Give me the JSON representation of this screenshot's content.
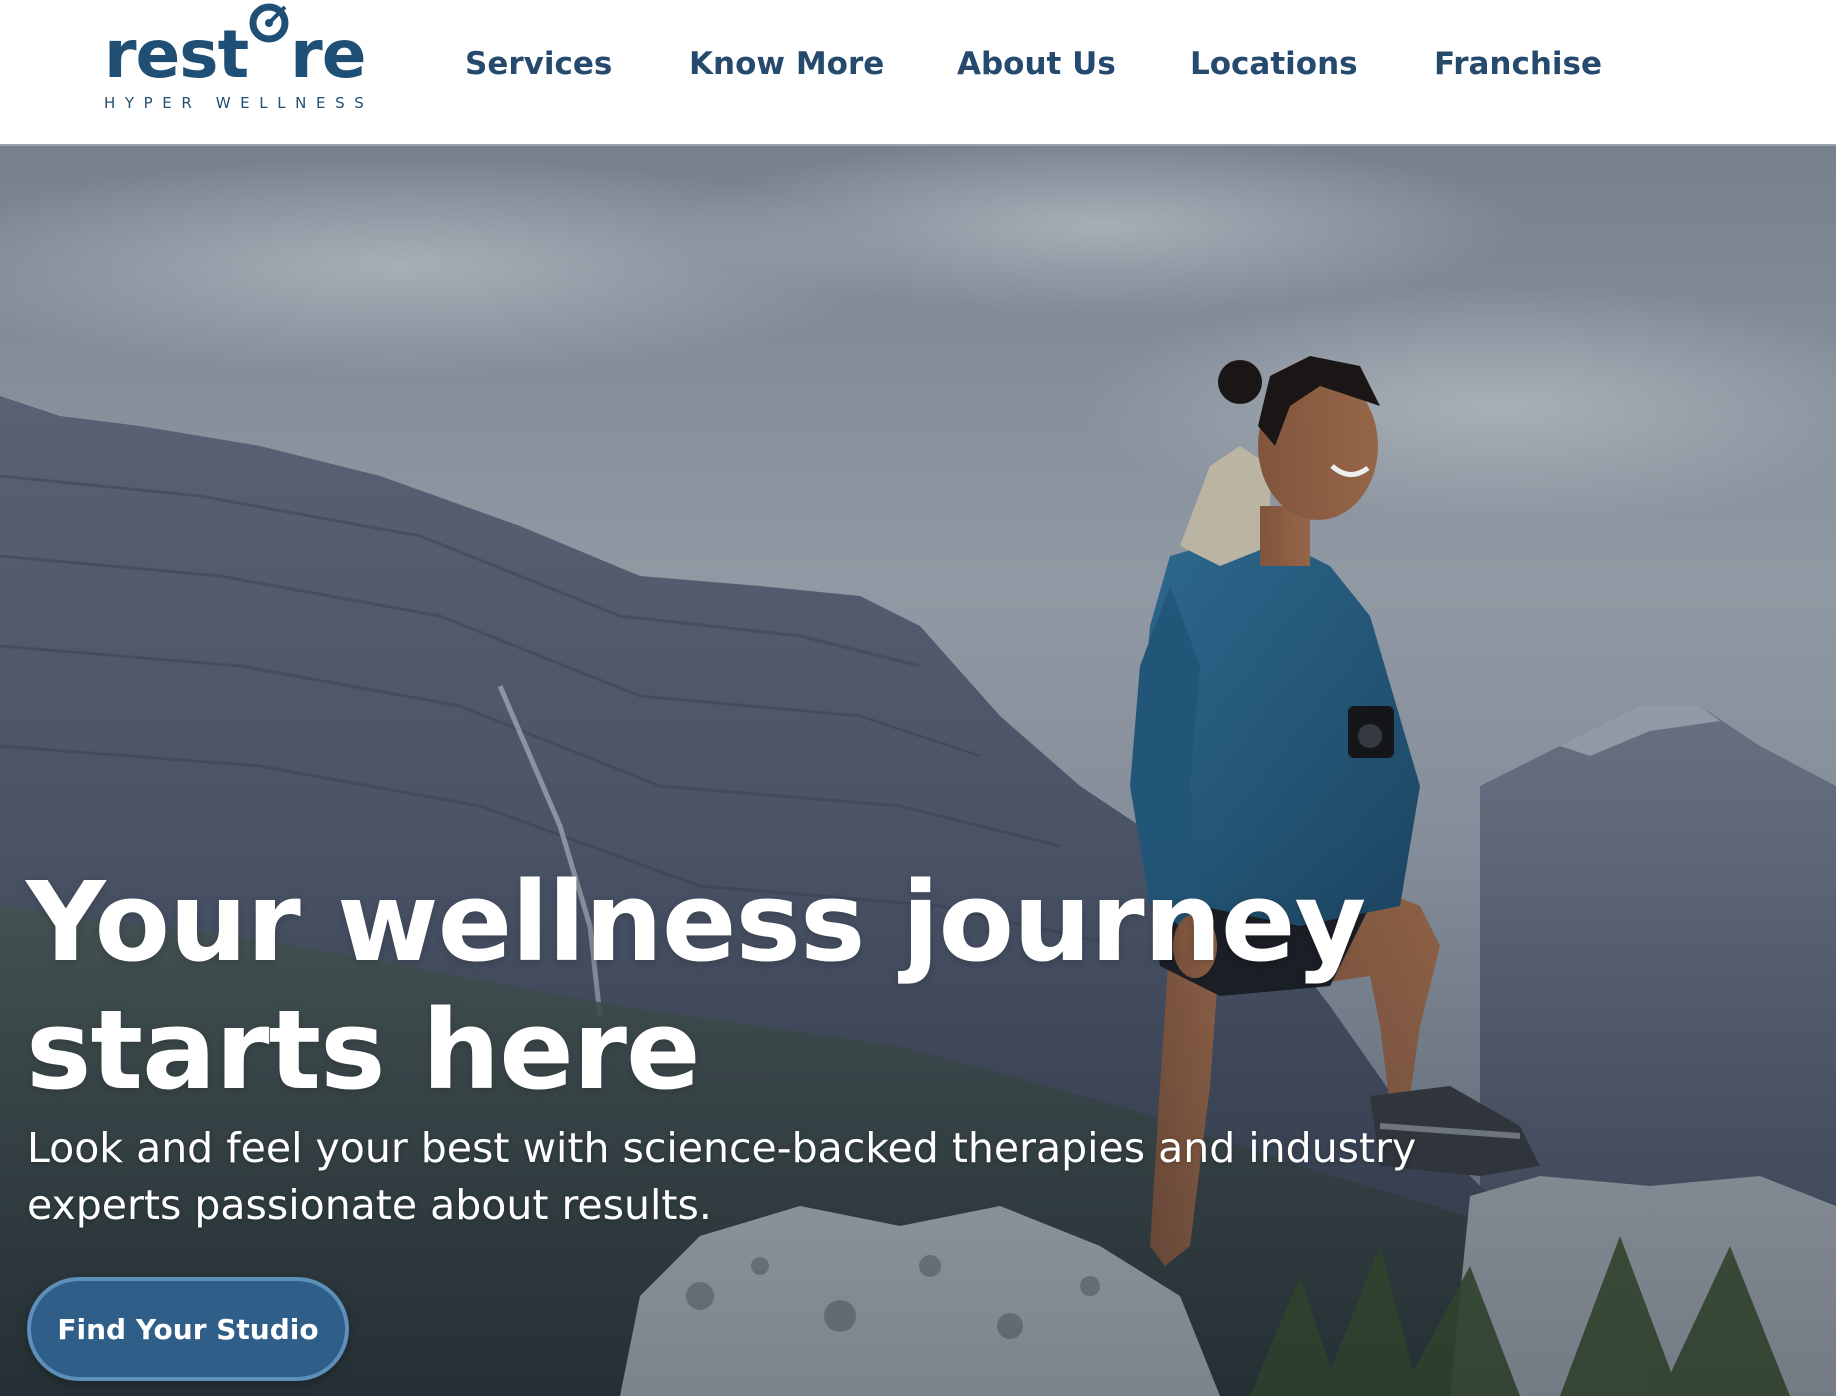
{
  "brand": {
    "logo_word": "restore",
    "logo_prefix": "rest",
    "logo_suffix": "re",
    "tagline": "HYPER WELLNESS",
    "color": "#1f4f74"
  },
  "nav": {
    "items": [
      {
        "label": "Services"
      },
      {
        "label": "Know More"
      },
      {
        "label": "About Us"
      },
      {
        "label": "Locations"
      },
      {
        "label": "Franchise"
      }
    ]
  },
  "hero": {
    "headline": "Your wellness journey starts here",
    "subheadline": "Look and feel your best with science-backed therapies and industry experts passionate about results.",
    "cta_label": "Find Your Studio",
    "image_icon": "hiker-on-mountain-photo"
  },
  "colors": {
    "nav_text": "#254a6e",
    "cta_bg": "#2f5f88",
    "cta_border": "#5d8fbb"
  }
}
